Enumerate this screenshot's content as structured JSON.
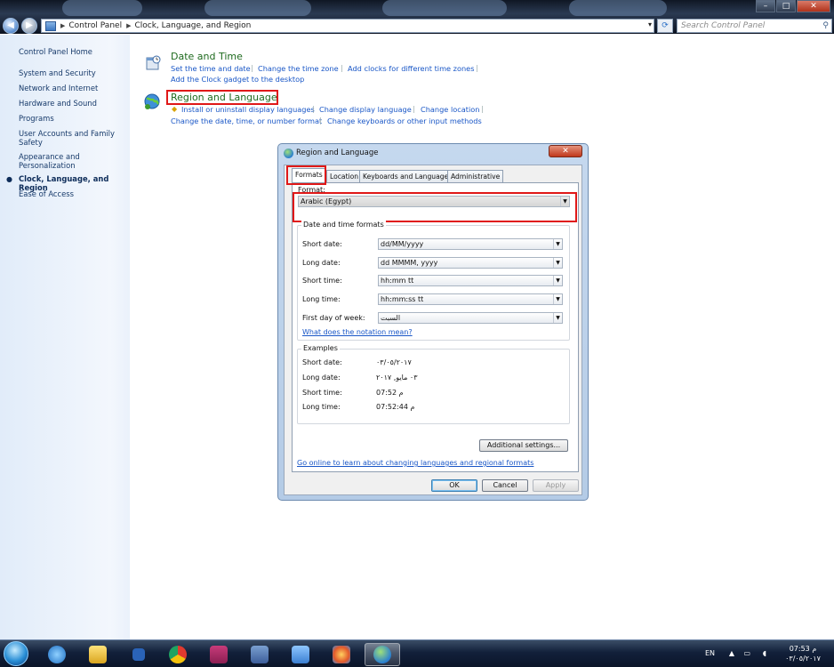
{
  "window": {
    "controls": {
      "minimize": "–",
      "maximize": "□",
      "close": "✕"
    }
  },
  "address": {
    "crumbs": [
      "Control Panel",
      "Clock, Language, and Region"
    ],
    "search_placeholder": "Search Control Panel"
  },
  "sidebar": {
    "items": [
      {
        "label": "Control Panel Home"
      },
      {
        "label": "System and Security"
      },
      {
        "label": "Network and Internet"
      },
      {
        "label": "Hardware and Sound"
      },
      {
        "label": "Programs"
      },
      {
        "label": "User Accounts and Family Safety"
      },
      {
        "label": "Appearance and Personalization"
      },
      {
        "label": "Clock, Language, and Region",
        "active": true
      },
      {
        "label": "Ease of Access"
      }
    ]
  },
  "main": {
    "categories": [
      {
        "title": "Date and Time",
        "links_row1": [
          "Set the time and date",
          "Change the time zone",
          "Add clocks for different time zones"
        ],
        "links_row2": [
          "Add the Clock gadget to the desktop"
        ]
      },
      {
        "title": "Region and Language",
        "links_row1": [
          "Install or uninstall display languages",
          "Change display language",
          "Change location"
        ],
        "links_row2": [
          "Change the date, time, or number format",
          "Change keyboards or other input methods"
        ]
      }
    ]
  },
  "dialog": {
    "title": "Region and Language",
    "tabs": [
      "Formats",
      "Location",
      "Keyboards and Languages",
      "Administrative"
    ],
    "format_label": "Format:",
    "format_value": "Arabic (Egypt)",
    "datetime_group": "Date and time formats",
    "fields": [
      {
        "label": "Short date:",
        "value": "dd/MM/yyyy"
      },
      {
        "label": "Long date:",
        "value": "dd MMMM, yyyy"
      },
      {
        "label": "Short time:",
        "value": "hh:mm tt"
      },
      {
        "label": "Long time:",
        "value": "hh:mm:ss tt"
      },
      {
        "label": "First day of week:",
        "value": "السبت"
      }
    ],
    "notation_link": "What does the notation mean?",
    "examples_group": "Examples",
    "examples": [
      {
        "label": "Short date:",
        "value": "٠٣/٠٥/٢٠١٧"
      },
      {
        "label": "Long date:",
        "value": "٠٣ مايو, ٢٠١٧"
      },
      {
        "label": "Short time:",
        "value": "07:52 م"
      },
      {
        "label": "Long time:",
        "value": "07:52:44 م"
      }
    ],
    "additional_button": "Additional settings...",
    "online_link": "Go online to learn about changing languages and regional formats",
    "ok": "OK",
    "cancel": "Cancel",
    "apply": "Apply"
  },
  "taskbar": {
    "language": "EN",
    "clock_time": "07:53 م",
    "clock_date": "٠٣/٠٥/٢٠١٧"
  }
}
